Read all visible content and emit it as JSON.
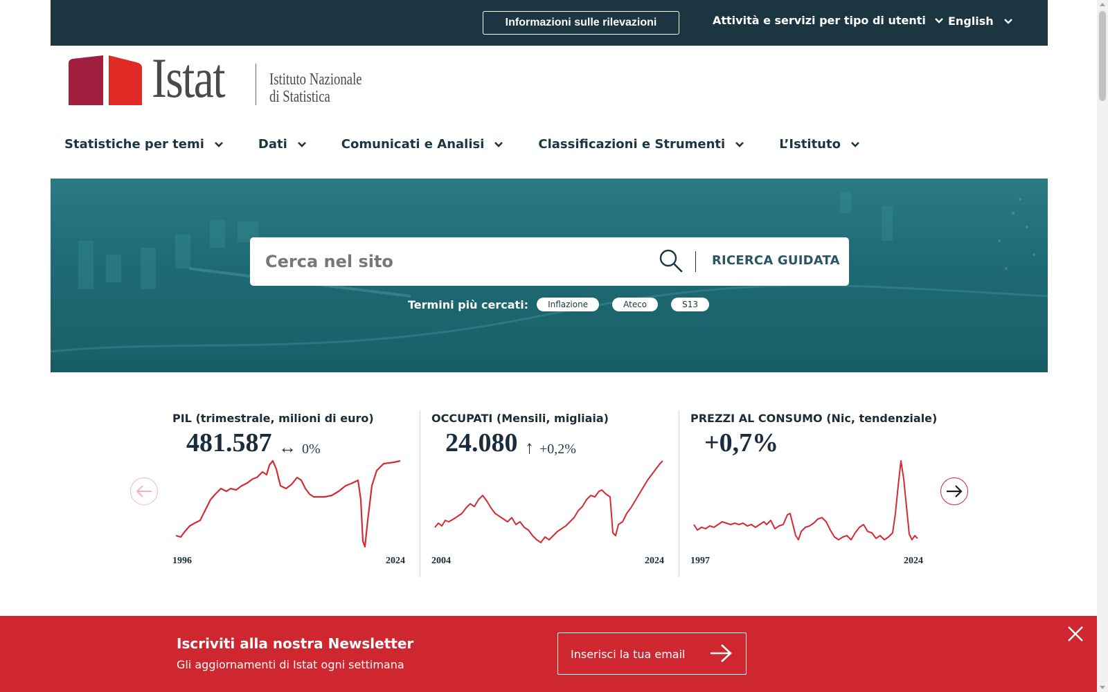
{
  "topbar": {
    "info_label": "Informazioni sulle rilevazioni",
    "users_label": "Attività e servizi per tipo di utenti",
    "language_label": "English"
  },
  "logo": {
    "wordmark": "Istat",
    "subtitle_line1": "Istituto Nazionale",
    "subtitle_line2": "di Statistica",
    "colors": {
      "dark_red": "#a11f3e",
      "red": "#e02a26"
    }
  },
  "nav": {
    "items": [
      {
        "label": "Statistiche per temi"
      },
      {
        "label": "Dati"
      },
      {
        "label": "Comunicati e Analisi"
      },
      {
        "label": "Classificazioni e Strumenti"
      },
      {
        "label": "L’Istituto"
      }
    ]
  },
  "search": {
    "placeholder": "Cerca nel sito",
    "guided_label": "RICERCA GUIDATA",
    "popular_label": "Termini più cercati:",
    "tags": [
      "Inflazione",
      "Ateco",
      "S13"
    ]
  },
  "indicators": [
    {
      "title": "PIL (trimestrale, milioni di euro)",
      "value": "481.587",
      "trend_symbol": "↔",
      "trend_text": "0%",
      "year_start": "1996",
      "year_end": "2024"
    },
    {
      "title": "OCCUPATI (Mensili, migliaia)",
      "value": "24.080",
      "trend_symbol": "↑",
      "trend_text": "+0,2%",
      "year_start": "2004",
      "year_end": "2024"
    },
    {
      "title": "PREZZI AL CONSUMO (Nic, tendenziale)",
      "value": "+0,7%",
      "trend_symbol": "",
      "trend_text": "",
      "year_start": "1997",
      "year_end": "2024"
    }
  ],
  "newsletter": {
    "title": "Iscriviti alla nostra Newsletter",
    "subtitle": "Gli aggiornamenti di Istat ogni settimana",
    "email_placeholder": "Inserisci la tua email"
  },
  "colors": {
    "topbar": "#1b3640",
    "accent_red": "#cf2730",
    "sparkline": "#d42a33",
    "hero": "#1e6a74"
  },
  "icons": {
    "chevron": "chevron-down-icon",
    "search": "search-icon",
    "prev": "arrow-left-icon",
    "next": "arrow-right-icon",
    "close": "close-icon"
  }
}
